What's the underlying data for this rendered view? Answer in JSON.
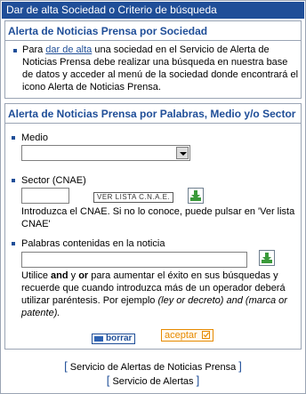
{
  "header": {
    "title": "Dar de alta Sociedad o Criterio de búsqueda"
  },
  "section1": {
    "title": "Alerta de Noticias Prensa por Sociedad",
    "text_before": "Para ",
    "link": "dar de alta",
    "text_after": " una sociedad en el Servicio de Alerta de Noticias Prensa debe realizar una búsqueda en nuestra base de datos y acceder al menú de la sociedad donde encontrará el icono Alerta de Noticias Prensa."
  },
  "section2": {
    "title": "Alerta de Noticias Prensa por Palabras, Medio y/o Sector",
    "medio": {
      "label": "Medio",
      "selected": ""
    },
    "sector": {
      "label": "Sector (CNAE)",
      "value": "",
      "list_button": "VER LISTA C.N.A.E.",
      "help": "Introduzca el CNAE. Si no lo conoce, puede pulsar en 'Ver lista CNAE'"
    },
    "palabras": {
      "label": "Palabras contenidas en la noticia",
      "value": "",
      "help_1": "Utilice ",
      "and": "and",
      "help_2": " y ",
      "or": "or",
      "help_3": " para aumentar el éxito en sus búsquedas y recuerde que cuando introduzca más de un operador deberá utilizar paréntesis. Por ejemplo ",
      "example": "(ley or decreto) and (marca or patente).",
      "help_end": ""
    },
    "borrar": "borrar",
    "aceptar": "aceptar"
  },
  "footer": {
    "link1": "Servicio de Alertas de Noticias Prensa",
    "link2": "Servicio de Alertas"
  },
  "icons": {
    "download": "download-arrow-icon",
    "eraser": "eraser-icon",
    "check": "checkbox-icon"
  },
  "colors": {
    "header_bg": "#1f4e98",
    "title": "#1f4e98",
    "accept": "#e68a00"
  }
}
